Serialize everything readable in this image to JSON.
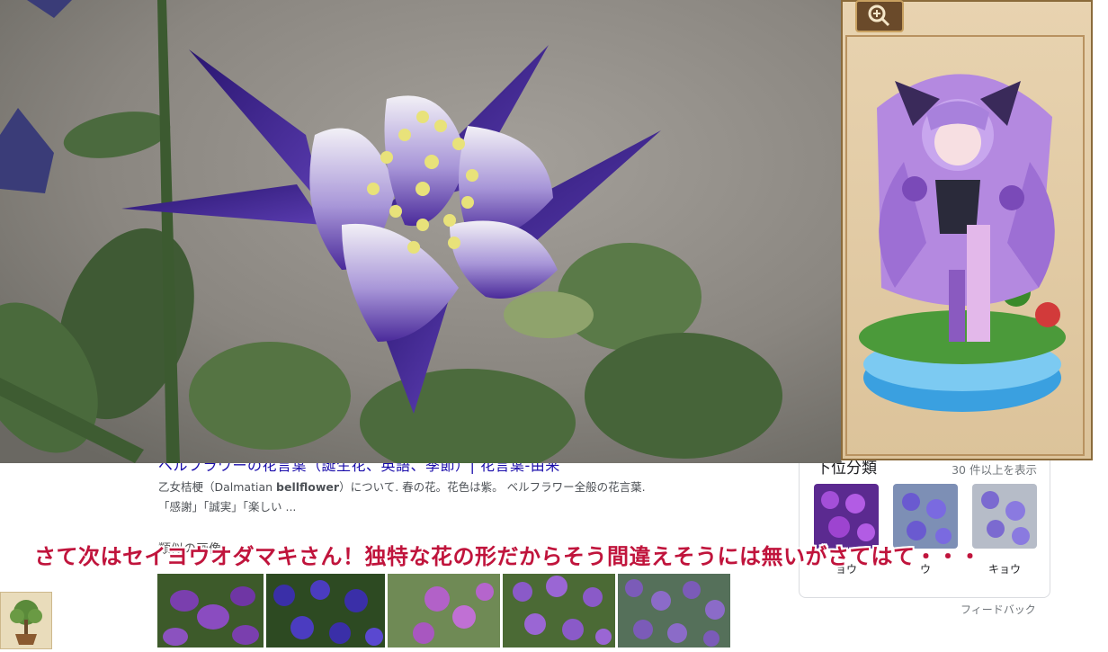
{
  "search_result": {
    "title": "ベルフラワーの花言葉（誕生花、英語、季節）| 花言葉-由来",
    "snippet_pre": "乙女桔梗（Dalmatian ",
    "snippet_bold": "bellflower",
    "snippet_post": "）について. 春の花。花色は紫。 ベルフラワー全般の花言葉.",
    "snippet_line2": "「感謝」「誠実」「楽しい ...",
    "similar_heading": "類似の画像"
  },
  "side_panel": {
    "title": "下位分類",
    "more": "30 件以上を表示",
    "items": [
      {
        "label": "ョウ"
      },
      {
        "label": "ウ"
      },
      {
        "label": "キョウ"
      }
    ],
    "feedback": "フィードバック"
  },
  "caption": "さて次はセイヨウオダマキさん！独特な花の形だからそう間違えそうには無いがさてはて・・・",
  "colors": {
    "caption": "#c0143c",
    "link": "#1a0dab",
    "flower_purple": "#4a2a9a"
  },
  "icons": {
    "zoom": "magnifier-icon",
    "corner": "bonsai-tree-icon"
  }
}
